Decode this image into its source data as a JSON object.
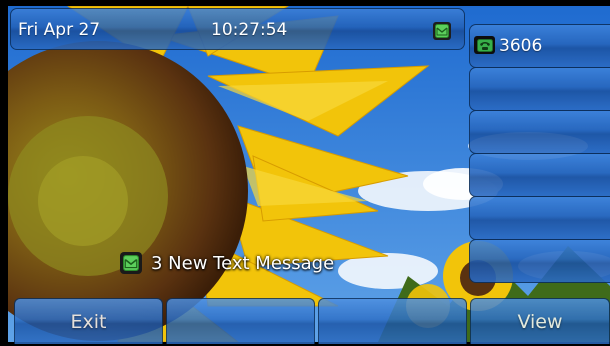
{
  "status_bar": {
    "date": "Fri Apr 27",
    "time": "10:27:54",
    "message_icon": "envelope-icon"
  },
  "lines": [
    {
      "label": "3606",
      "icon": "phone-icon"
    },
    {
      "label": ""
    },
    {
      "label": ""
    },
    {
      "label": ""
    },
    {
      "label": ""
    },
    {
      "label": ""
    }
  ],
  "notification": {
    "text": "3 New Text Message",
    "icon": "envelope-icon"
  },
  "softkeys": [
    {
      "label": "Exit"
    },
    {
      "label": ""
    },
    {
      "label": ""
    },
    {
      "label": "View"
    }
  ],
  "colors": {
    "button_blue": "#2462b8",
    "sky": "#2f7fd8",
    "petal": "#f4c80a",
    "center": "#6b3a10",
    "leaf": "#4e7a1e"
  }
}
